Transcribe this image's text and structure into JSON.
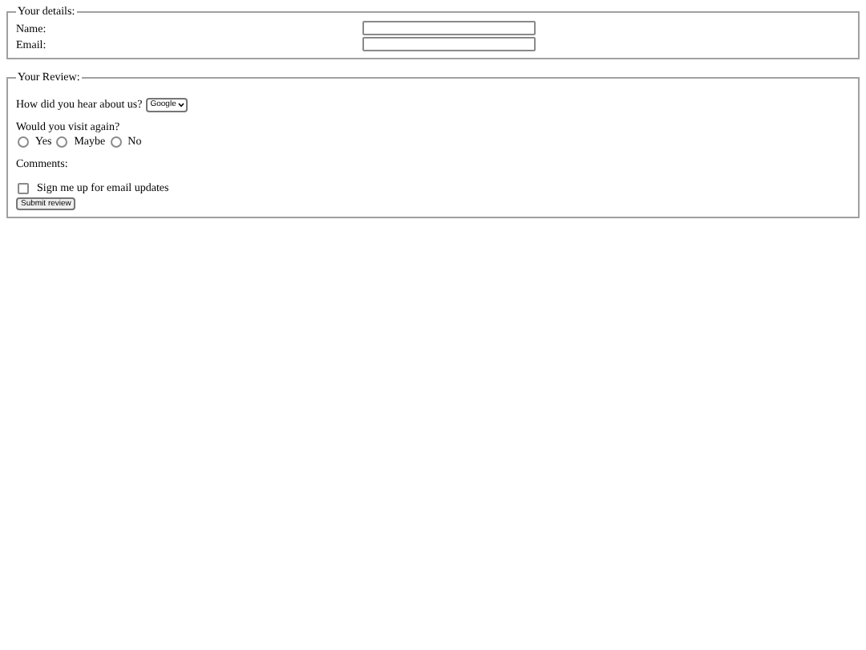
{
  "details": {
    "legend": "Your details:",
    "fields": [
      {
        "label": "Name:"
      },
      {
        "label": "Email:"
      }
    ]
  },
  "review": {
    "legend": "Your Review:",
    "source": {
      "label": "How did you hear about us?",
      "value": "Google"
    },
    "visit": {
      "label": "Would you visit again?",
      "options": [
        {
          "label": "Yes",
          "selected": false
        },
        {
          "label": "Maybe",
          "selected": false
        },
        {
          "label": "No",
          "selected": false
        }
      ]
    },
    "comments": {
      "label": "Comments:"
    },
    "updates": {
      "label": "Sign me up for email updates",
      "checked": false
    },
    "submit": "Submit review"
  }
}
